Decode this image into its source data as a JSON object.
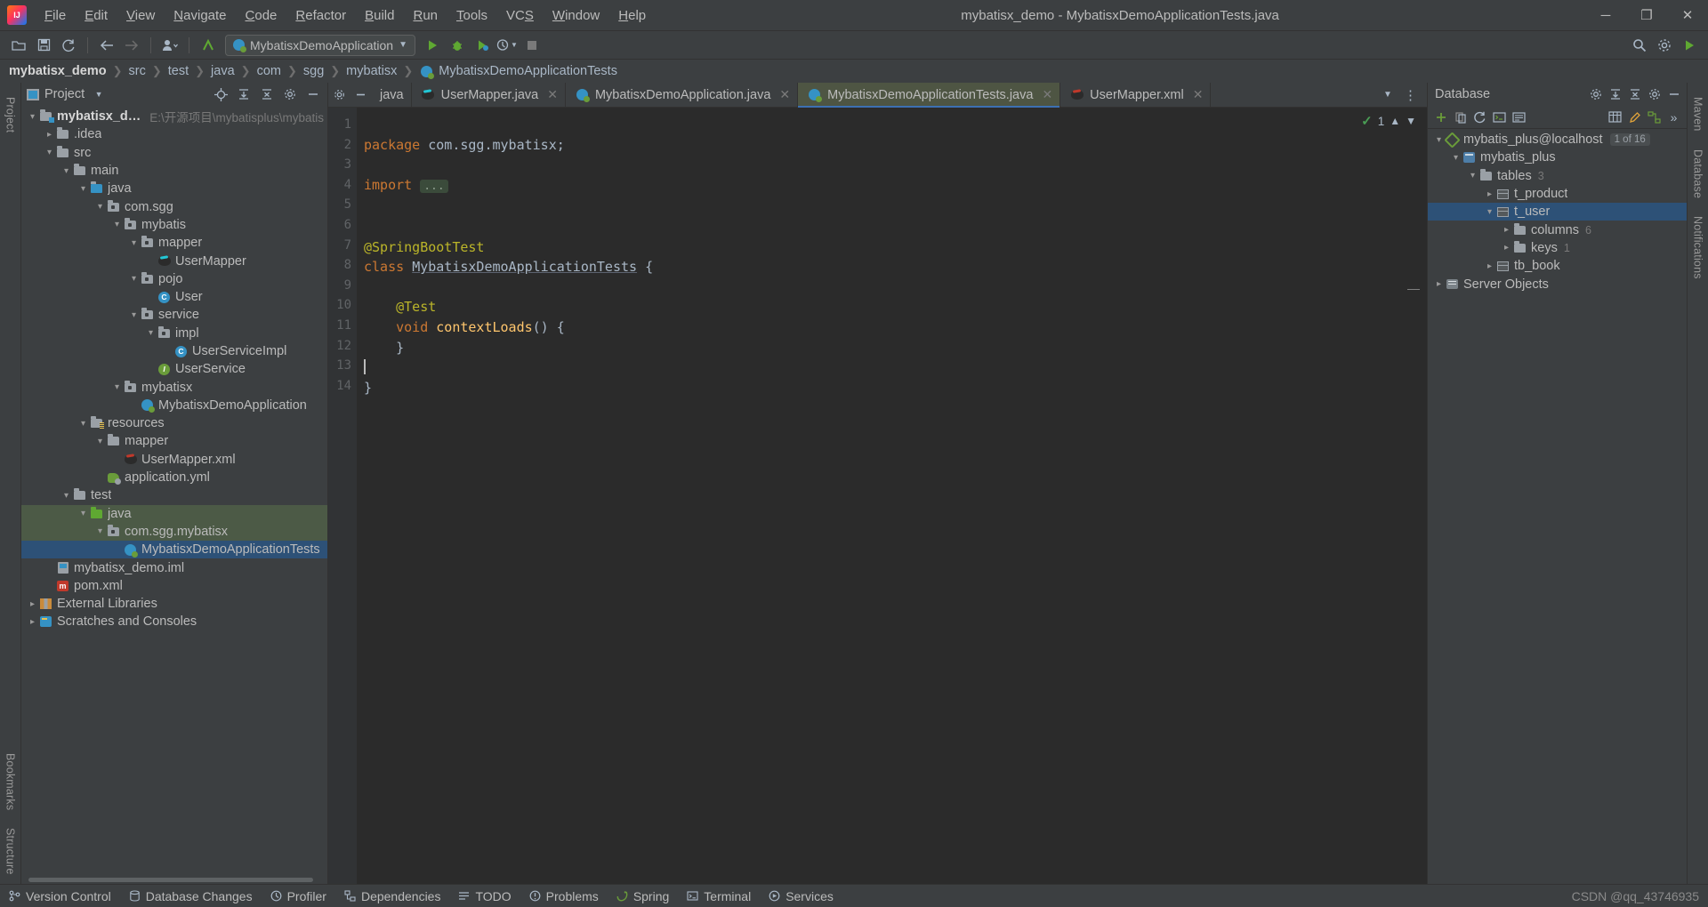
{
  "window": {
    "title": "mybatisx_demo - MybatisxDemoApplicationTests.java",
    "logo": "intellij-idea-logo",
    "minimize": "─",
    "maximize": "❐",
    "close": "✕"
  },
  "menu": [
    {
      "label": "File",
      "mnemonic": "F"
    },
    {
      "label": "Edit",
      "mnemonic": "E"
    },
    {
      "label": "View",
      "mnemonic": "V"
    },
    {
      "label": "Navigate",
      "mnemonic": "N"
    },
    {
      "label": "Code",
      "mnemonic": "C"
    },
    {
      "label": "Refactor",
      "mnemonic": "R"
    },
    {
      "label": "Build",
      "mnemonic": "B"
    },
    {
      "label": "Run",
      "mnemonic": "R"
    },
    {
      "label": "Tools",
      "mnemonic": "T"
    },
    {
      "label": "VCS",
      "mnemonic": "S"
    },
    {
      "label": "Window",
      "mnemonic": "W"
    },
    {
      "label": "Help",
      "mnemonic": "H"
    }
  ],
  "toolbar": {
    "open_label": "📂",
    "save_label": "💾",
    "sync_label": "↻",
    "back_label": "←",
    "forward_label": "→",
    "profile_label": "👤",
    "updates_label": "‹",
    "run_config": "MybatisxDemoApplication",
    "run_label": "▶",
    "debug_label": "🐞",
    "coverage_label": "◩",
    "profiler_label": "⏱",
    "stop_label": "■",
    "search_label": "🔍",
    "settings_label": "⚙",
    "updates_right_label": "▶"
  },
  "breadcrumb": [
    "mybatisx_demo",
    "src",
    "test",
    "java",
    "com",
    "sgg",
    "mybatisx",
    "MybatisxDemoApplicationTests"
  ],
  "project_panel": {
    "title": "Project",
    "dropdown_icon": "chevron-down-icon",
    "locate_icon": "crosshair-icon",
    "expand_icon": "expand-all-icon",
    "collapse_icon": "collapse-all-icon",
    "options_icon": "gear-icon",
    "hide_icon": "minimize-icon",
    "tree": [
      {
        "label": "mybatisx_demo",
        "note": "E:\\开源项目\\mybatisplus\\mybatis",
        "depth": 0,
        "arrow": "v",
        "icon": "module-folder",
        "bold": true
      },
      {
        "label": ".idea",
        "depth": 1,
        "arrow": ">",
        "icon": "folder"
      },
      {
        "label": "src",
        "depth": 1,
        "arrow": "v",
        "icon": "folder"
      },
      {
        "label": "main",
        "depth": 2,
        "arrow": "v",
        "icon": "folder"
      },
      {
        "label": "java",
        "depth": 3,
        "arrow": "v",
        "icon": "folder-source"
      },
      {
        "label": "com.sgg",
        "depth": 4,
        "arrow": "v",
        "icon": "package"
      },
      {
        "label": "mybatis",
        "depth": 5,
        "arrow": "v",
        "icon": "package"
      },
      {
        "label": "mapper",
        "depth": 6,
        "arrow": "v",
        "icon": "package"
      },
      {
        "label": "UserMapper",
        "depth": 7,
        "arrow": "",
        "icon": "mybatis-mapper"
      },
      {
        "label": "pojo",
        "depth": 6,
        "arrow": "v",
        "icon": "package"
      },
      {
        "label": "User",
        "depth": 7,
        "arrow": "",
        "icon": "class"
      },
      {
        "label": "service",
        "depth": 6,
        "arrow": "v",
        "icon": "package"
      },
      {
        "label": "impl",
        "depth": 7,
        "arrow": "v",
        "icon": "package"
      },
      {
        "label": "UserServiceImpl",
        "depth": 8,
        "arrow": "",
        "icon": "class"
      },
      {
        "label": "UserService",
        "depth": 7,
        "arrow": "",
        "icon": "interface"
      },
      {
        "label": "mybatisx",
        "depth": 5,
        "arrow": "v",
        "icon": "package"
      },
      {
        "label": "MybatisxDemoApplication",
        "depth": 6,
        "arrow": "",
        "icon": "spring-class"
      },
      {
        "label": "resources",
        "depth": 3,
        "arrow": "v",
        "icon": "folder-resource"
      },
      {
        "label": "mapper",
        "depth": 4,
        "arrow": "v",
        "icon": "folder"
      },
      {
        "label": "UserMapper.xml",
        "depth": 5,
        "arrow": "",
        "icon": "mybatis-xml"
      },
      {
        "label": "application.yml",
        "depth": 4,
        "arrow": "",
        "icon": "spring-yaml"
      },
      {
        "label": "test",
        "depth": 2,
        "arrow": "v",
        "icon": "folder"
      },
      {
        "label": "java",
        "depth": 3,
        "arrow": "v",
        "icon": "folder-test",
        "selected": "green"
      },
      {
        "label": "com.sgg.mybatisx",
        "depth": 4,
        "arrow": "v",
        "icon": "package",
        "selected": "green"
      },
      {
        "label": "MybatisxDemoApplicationTests",
        "depth": 5,
        "arrow": "",
        "icon": "spring-class",
        "selected": "blue"
      },
      {
        "label": "mybatisx_demo.iml",
        "depth": 1,
        "arrow": "",
        "icon": "iml"
      },
      {
        "label": "pom.xml",
        "depth": 1,
        "arrow": "",
        "icon": "maven"
      },
      {
        "label": "External Libraries",
        "depth": 0,
        "arrow": ">",
        "icon": "library"
      },
      {
        "label": "Scratches and Consoles",
        "depth": 0,
        "arrow": ">",
        "icon": "scratch"
      }
    ]
  },
  "editor": {
    "tabs": [
      {
        "label": "java",
        "icon": "folder-icon",
        "active": false
      },
      {
        "label": "UserMapper.java",
        "icon": "mybatis-mapper-icon",
        "active": false
      },
      {
        "label": "MybatisxDemoApplication.java",
        "icon": "spring-class-icon",
        "active": false
      },
      {
        "label": "MybatisxDemoApplicationTests.java",
        "icon": "spring-class-icon",
        "active": true
      },
      {
        "label": "UserMapper.xml",
        "icon": "mybatis-xml-icon",
        "active": false
      }
    ],
    "tab_list_icon": "chevron-down-icon",
    "tab_menu_icon": "more-vertical-icon",
    "settings_icon": "gear-icon",
    "hide_icon": "minimize-icon",
    "inspection": {
      "count": "1",
      "check_icon": "check-icon",
      "up_icon": "chevron-up-icon",
      "down_icon": "chevron-down-icon"
    },
    "line_numbers": [
      "1",
      "2",
      "3",
      "4",
      "5",
      "6",
      "7",
      "8",
      "9",
      "10",
      "11",
      "12",
      "13",
      "14"
    ],
    "code_lines": [
      "package com.sgg.mybatisx;",
      "",
      "import ...",
      "",
      "",
      "@SpringBootTest",
      "class MybatisxDemoApplicationTests {",
      "",
      "    @Test",
      "    void contextLoads() {",
      "    }",
      "",
      "}",
      ""
    ],
    "fold_placeholder": "..."
  },
  "database_panel": {
    "title": "Database",
    "add_icon": "plus-icon",
    "copy_icon": "copy-icon",
    "refresh_icon": "refresh-icon",
    "console_icon": "console-icon",
    "script_icon": "script-icon",
    "table_icon": "table-icon",
    "modify_icon": "edit-icon",
    "diagram_icon": "diagram-icon",
    "expand_icon": "chevron-right-icon",
    "settings_icon": "gear-icon",
    "hide_icon": "minimize-icon",
    "tree": [
      {
        "label": "mybatis_plus@localhost",
        "depth": 0,
        "arrow": "v",
        "icon": "db-connection",
        "badge": "1 of 16"
      },
      {
        "label": "mybatis_plus",
        "depth": 1,
        "arrow": "v",
        "icon": "db-schema"
      },
      {
        "label": "tables",
        "depth": 2,
        "arrow": "v",
        "icon": "folder",
        "count": "3"
      },
      {
        "label": "t_product",
        "depth": 3,
        "arrow": ">",
        "icon": "db-table"
      },
      {
        "label": "t_user",
        "depth": 3,
        "arrow": "v",
        "icon": "db-table",
        "selected": true
      },
      {
        "label": "columns",
        "depth": 4,
        "arrow": ">",
        "icon": "folder",
        "count": "6"
      },
      {
        "label": "keys",
        "depth": 4,
        "arrow": ">",
        "icon": "folder",
        "count": "1"
      },
      {
        "label": "tb_book",
        "depth": 3,
        "arrow": ">",
        "icon": "db-table"
      },
      {
        "label": "Server Objects",
        "depth": 0,
        "arrow": ">",
        "icon": "server-objects"
      }
    ]
  },
  "left_rail": {
    "top_label": "Project",
    "bottom_labels": [
      "Bookmarks",
      "Structure"
    ]
  },
  "right_rail": {
    "labels": [
      "Maven",
      "Database",
      "Notifications"
    ]
  },
  "statusbar": {
    "items": [
      {
        "label": "Version Control",
        "icon": "branch-icon"
      },
      {
        "label": "Database Changes",
        "icon": "database-icon"
      },
      {
        "label": "Profiler",
        "icon": "profiler-icon"
      },
      {
        "label": "Dependencies",
        "icon": "dependencies-icon"
      },
      {
        "label": "TODO",
        "icon": "todo-icon"
      },
      {
        "label": "Problems",
        "icon": "problems-icon"
      },
      {
        "label": "Spring",
        "icon": "spring-icon"
      },
      {
        "label": "Terminal",
        "icon": "terminal-icon"
      },
      {
        "label": "Services",
        "icon": "services-icon"
      }
    ],
    "watermark": "CSDN @qq_43746935"
  },
  "colors": {
    "accent_blue": "#3592c4",
    "selection_blue": "#2d5177",
    "selection_green": "#4c5a46",
    "panel_bg": "#3c3f41",
    "editor_bg": "#2b2b2b",
    "keyword_orange": "#cc7832",
    "annotation_yellow": "#bbb529",
    "method_yellow": "#ffc66d",
    "string_green": "#6a8759"
  }
}
